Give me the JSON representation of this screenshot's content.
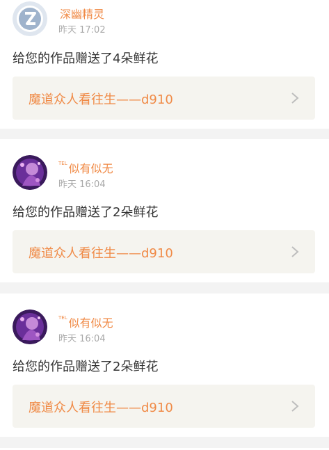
{
  "colors": {
    "accent": "#f08a46",
    "time": "#a9a9a9",
    "text": "#333333",
    "card_bg": "#ffffff",
    "page_bg": "#f3f3f3",
    "work_bg": "#f5f4ef"
  },
  "notifications": [
    {
      "avatar_icon": "z-logo-avatar",
      "name_prefix": "",
      "name": "深幽精灵",
      "time": "昨天 17:02",
      "message": "给您的作品赠送了4朵鲜花",
      "work_title": "魔道众人看往生——d910"
    },
    {
      "avatar_icon": "purple-photo-avatar",
      "name_prefix": "TEL",
      "name": "似有似无",
      "time": "昨天 16:04",
      "message": "给您的作品赠送了2朵鲜花",
      "work_title": "魔道众人看往生——d910"
    },
    {
      "avatar_icon": "purple-photo-avatar",
      "name_prefix": "TEL",
      "name": "似有似无",
      "time": "昨天 16:04",
      "message": "给您的作品赠送了2朵鲜花",
      "work_title": "魔道众人看往生——d910"
    }
  ]
}
